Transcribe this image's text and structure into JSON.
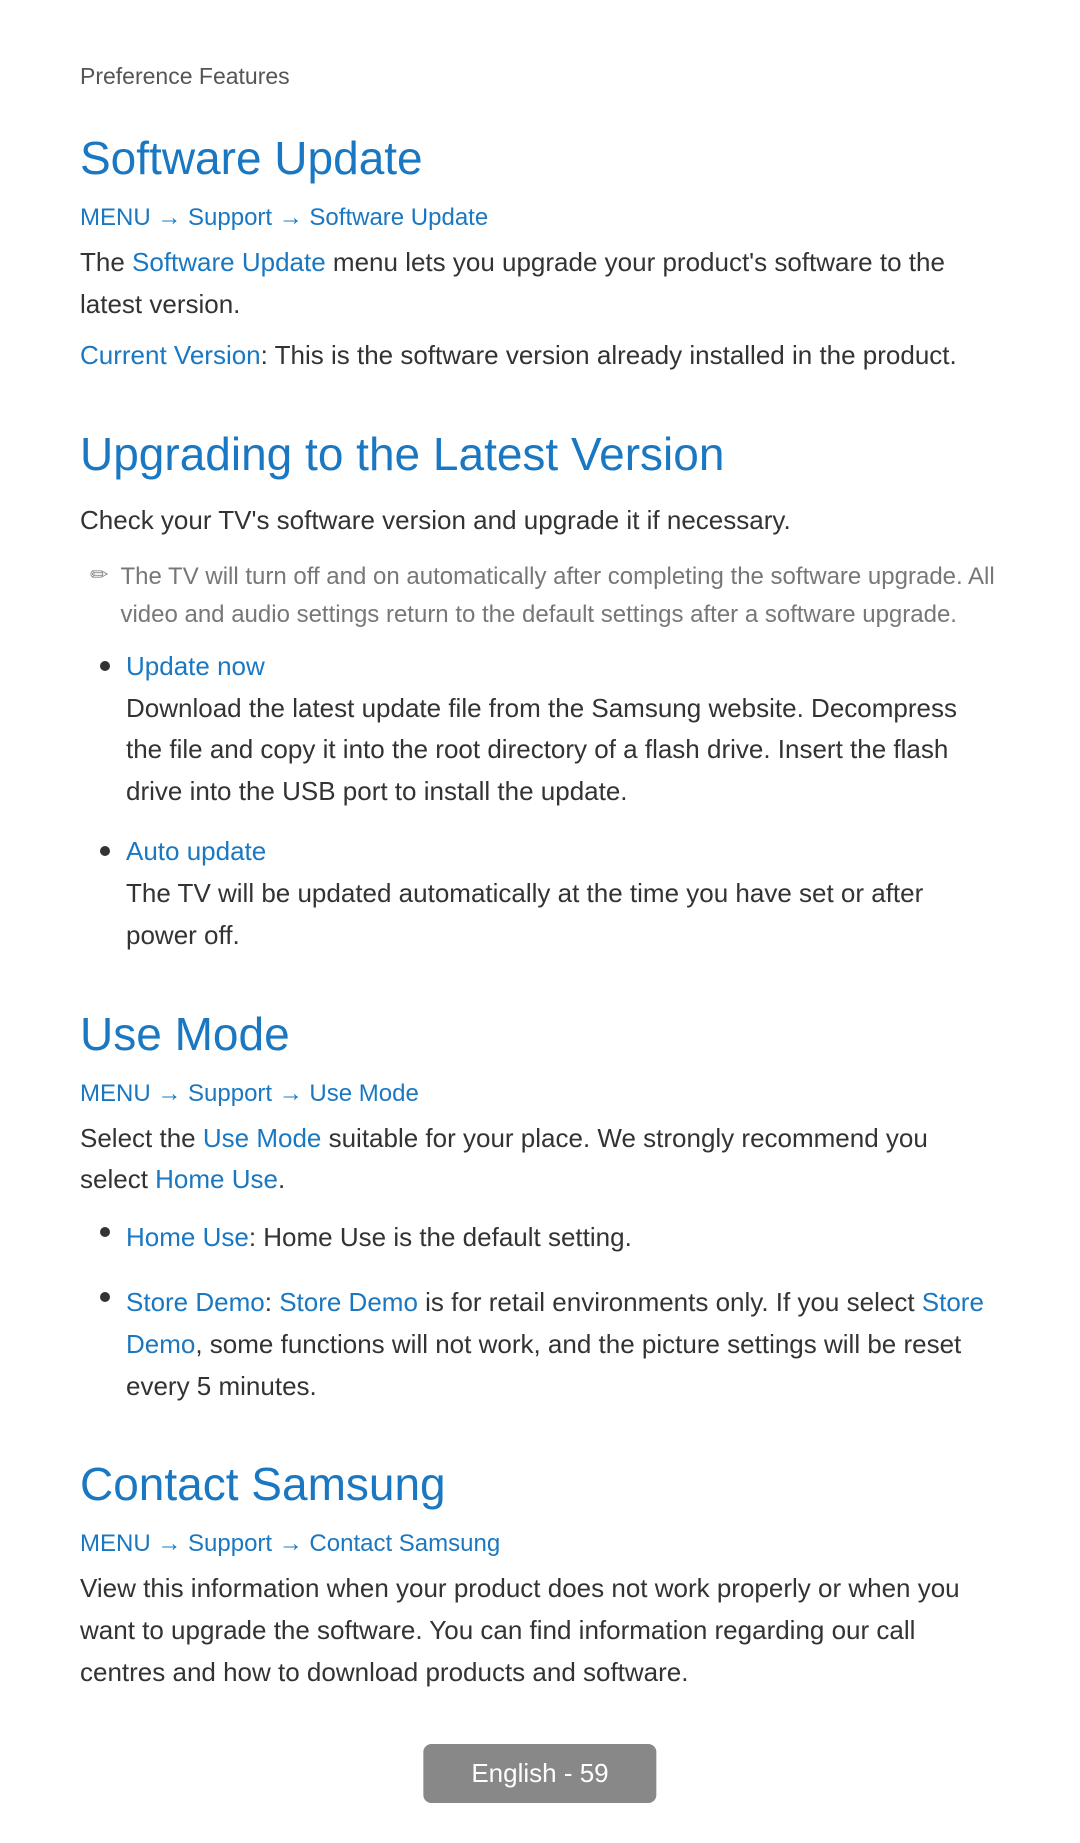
{
  "breadcrumb": {
    "label": "Preference Features"
  },
  "sections": {
    "software_update": {
      "title": "Software Update",
      "nav": {
        "menu": "MENU",
        "arrow1": "→",
        "support": "Support",
        "arrow2": "→",
        "page": "Software Update"
      },
      "description_before": "The ",
      "description_highlight": "Software Update",
      "description_after": " menu lets you upgrade your product's software to the latest version.",
      "current_version_label": "Current Version",
      "current_version_text": ": This is the software version already installed in the product."
    },
    "upgrading": {
      "title": "Upgrading to the Latest Version",
      "check_text": "Check your TV's software version and upgrade it if necessary.",
      "note": "The TV will turn off and on automatically after completing the software upgrade. All video and audio settings return to the default settings after a software upgrade.",
      "items": [
        {
          "title": "Update now",
          "description": "Download the latest update file from the Samsung website. Decompress the file and copy it into the root directory of a flash drive. Insert the flash drive into the USB port to install the update."
        },
        {
          "title": "Auto update",
          "description": "The TV will be updated automatically at the time you have set or after power off."
        }
      ]
    },
    "use_mode": {
      "title": "Use Mode",
      "nav": {
        "menu": "MENU",
        "arrow1": "→",
        "support": "Support",
        "arrow2": "→",
        "page": "Use Mode"
      },
      "description_before": "Select the ",
      "description_highlight1": "Use Mode",
      "description_middle": " suitable for your place. We strongly recommend you select ",
      "description_highlight2": "Home Use",
      "description_end": ".",
      "items": [
        {
          "title": "Home Use",
          "title_suffix": ": Home Use is the default setting.",
          "description": ""
        },
        {
          "title": "Store Demo",
          "title_suffix": ": ",
          "title_highlight": "Store Demo",
          "description_before": " is for retail environments only. If you select ",
          "description_highlight": "Store Demo",
          "description_after": ", some functions will not work, and the picture settings will be reset every 5 minutes."
        }
      ]
    },
    "contact_samsung": {
      "title": "Contact Samsung",
      "nav": {
        "menu": "MENU",
        "arrow1": "→",
        "support": "Support",
        "arrow2": "→",
        "page": "Contact Samsung"
      },
      "description": "View this information when your product does not work properly or when you want to upgrade the software. You can find information regarding our call centres and how to download products and software."
    }
  },
  "footer": {
    "label": "English - 59"
  }
}
